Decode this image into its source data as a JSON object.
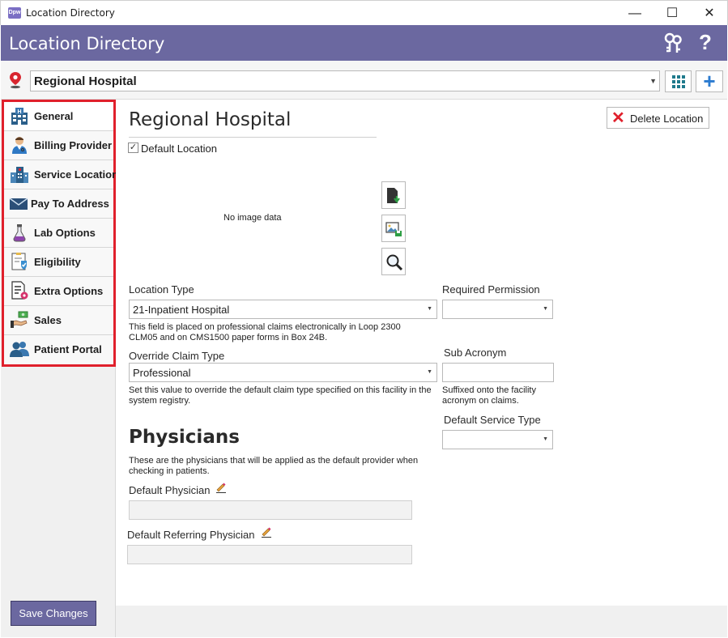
{
  "window": {
    "title": "Location Directory",
    "app_icon_text": "Dpw",
    "minimize_glyph": "—",
    "maximize_glyph": "☐",
    "close_glyph": "✕"
  },
  "header": {
    "title": "Location Directory",
    "help_glyph": "?",
    "background_color": "#6b68a0"
  },
  "location_selector": {
    "value": "Regional Hospital",
    "add_glyph": "+"
  },
  "sidebar": {
    "items": [
      {
        "label": "General",
        "icon": "hospital-icon"
      },
      {
        "label": "Billing Provider",
        "icon": "doctor-icon"
      },
      {
        "label": "Service Location",
        "icon": "building-icon"
      },
      {
        "label": "Pay To Address",
        "icon": "envelope-icon"
      },
      {
        "label": "Lab Options",
        "icon": "flask-icon"
      },
      {
        "label": "Eligibility",
        "icon": "checklist-shield-icon"
      },
      {
        "label": "Extra Options",
        "icon": "document-gear-icon"
      },
      {
        "label": "Sales",
        "icon": "money-hand-icon"
      },
      {
        "label": "Patient Portal",
        "icon": "users-icon"
      }
    ],
    "active_index": 0,
    "save_label": "Save Changes",
    "highlight_color": "#e0202c"
  },
  "main": {
    "title": "Regional Hospital",
    "delete_label": "Delete Location",
    "default_location_label": "Default Location",
    "default_location_checked": true,
    "no_image_text": "No image data",
    "location_type": {
      "label": "Location Type",
      "value": "21-Inpatient Hospital",
      "help": "This field is placed on professional claims electronically in Loop 2300 CLM05 and on CMS1500 paper forms in Box 24B."
    },
    "required_permission": {
      "label": "Required Permission",
      "value": ""
    },
    "override_claim_type": {
      "label": "Override Claim Type",
      "value": "Professional",
      "help": "Set this value to override the default claim type specified on this facility in the system registry."
    },
    "sub_acronym": {
      "label": "Sub Acronym",
      "value": "",
      "help": "Suffixed onto the facility acronym on claims."
    },
    "default_service_type": {
      "label": "Default Service Type",
      "value": ""
    },
    "physicians": {
      "title": "Physicians",
      "help": "These are the physicians that will be applied as the default provider when checking in patients.",
      "default_physician_label": "Default Physician",
      "default_physician_value": "",
      "default_referring_label": "Default Referring Physician",
      "default_referring_value": ""
    }
  }
}
